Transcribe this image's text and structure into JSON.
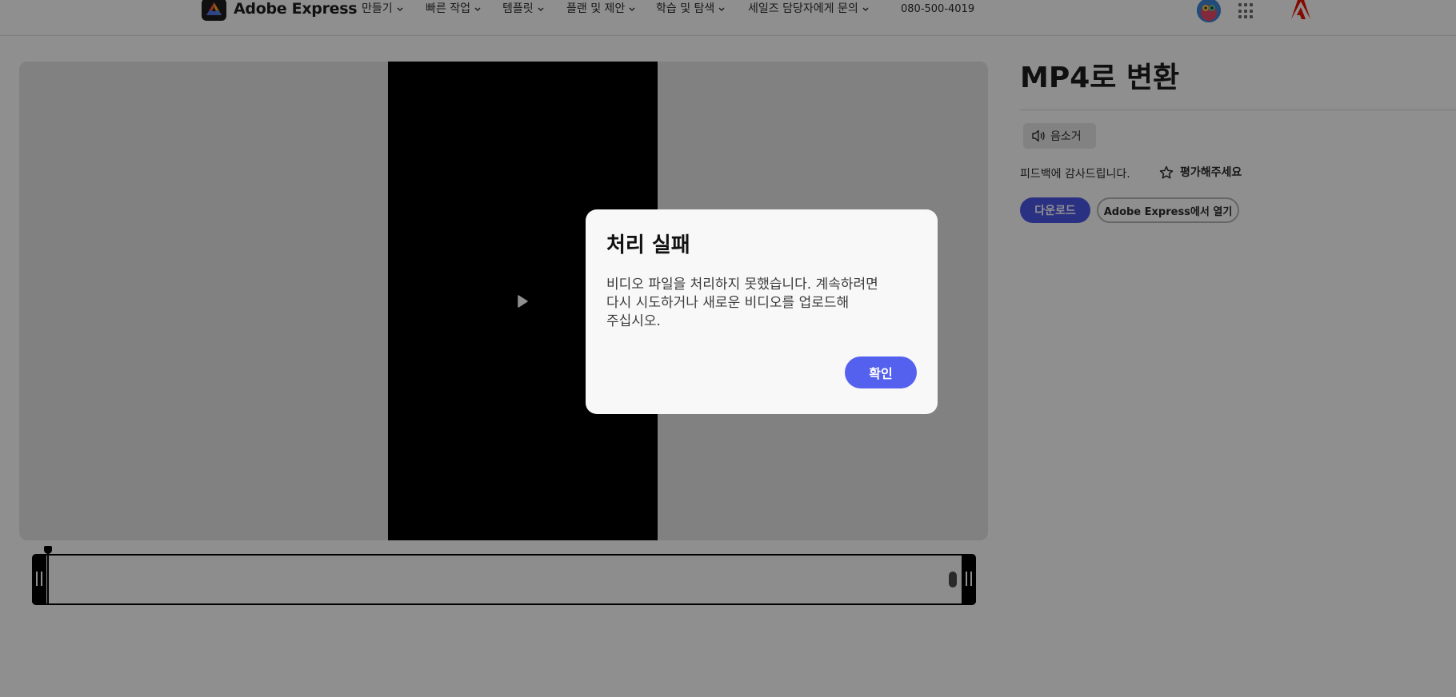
{
  "header": {
    "brand": "Adobe Express",
    "nav": [
      {
        "label": "만들기"
      },
      {
        "label": "빠른 작업"
      },
      {
        "label": "템플릿"
      },
      {
        "label": "플랜 및 제안"
      },
      {
        "label": "학습 및 탐색"
      },
      {
        "label": "세일즈 담당자에게 문의"
      }
    ],
    "phone": "080-500-4019",
    "icons": [
      "adobe-express-logo-icon",
      "avatar",
      "apps-grid-icon",
      "adobe-logo-icon"
    ]
  },
  "preview": {
    "icons": [
      "play-icon"
    ]
  },
  "side_panel": {
    "title": "MP4로 변환",
    "mute_label": "음소거",
    "feedback_text": "피드백에 감사드립니다.",
    "rate_label": "평가해주세요",
    "download_label": "다운로드",
    "open_label": "Adobe Express에서 열기"
  },
  "dialog": {
    "title": "처리 실패",
    "body_lines": [
      "비디오 파일을 처리하지 못했습니다. 계속하려면",
      "다시 시도하거나 새로운 비디오를 업로드해",
      "주십시오."
    ],
    "confirm_label": "확인"
  },
  "colors": {
    "accent": "#5460ee",
    "download": "#4b57e8",
    "overlay": "rgba(0,0,0,0.44)"
  }
}
